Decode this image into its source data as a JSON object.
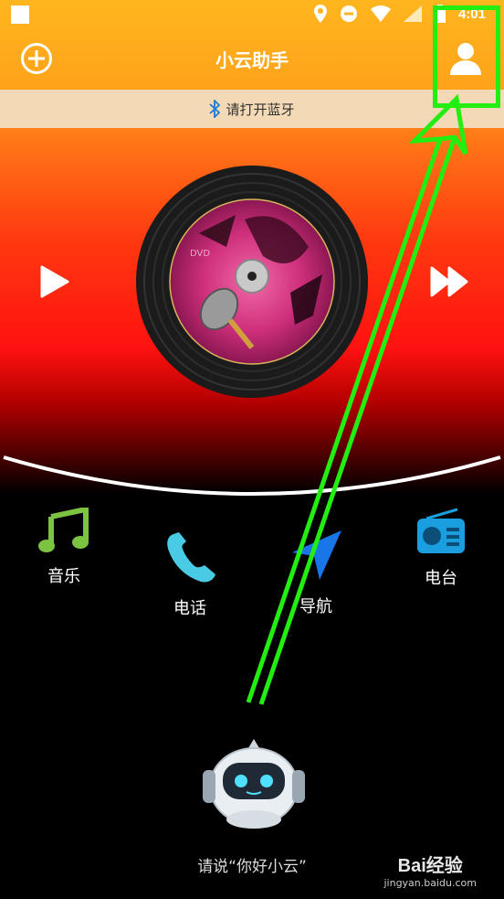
{
  "app": {
    "title": "小云助手"
  },
  "status_bar": {
    "time": "4:01"
  },
  "banner": {
    "bluetooth_text": "请打开蓝牙"
  },
  "menu": [
    {
      "label": "音乐",
      "icon": "music-note-icon",
      "color": "#7cc341"
    },
    {
      "label": "电话",
      "icon": "phone-icon",
      "color": "#49cbe6"
    },
    {
      "label": "导航",
      "icon": "navigation-arrow-icon",
      "color": "#1976e8"
    },
    {
      "label": "电台",
      "icon": "radio-icon",
      "color": "#1a9ee0"
    }
  ],
  "voice": {
    "hint": "请说“你好小云”"
  },
  "watermark": {
    "logo": "Bai经验",
    "url": "jingyan.baidu.com"
  },
  "colors": {
    "accent_orange": "#ffb61e",
    "annotation_green": "#22ee11"
  }
}
